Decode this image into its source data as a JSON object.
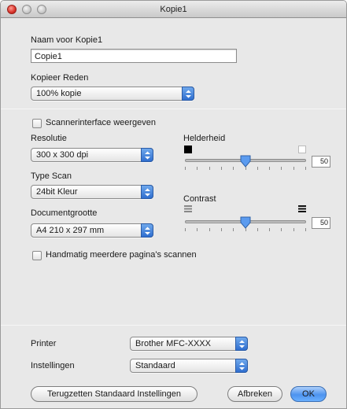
{
  "window": {
    "title": "Kopie1"
  },
  "name_section": {
    "label": "Naam voor Kopie1",
    "value": "Copie1"
  },
  "reason": {
    "label": "Kopieer Reden",
    "value": "100% kopie"
  },
  "scanner_interface": {
    "label": "Scannerinterface weergeven",
    "checked": false
  },
  "resolution": {
    "label": "Resolutie",
    "value": "300 x 300 dpi"
  },
  "scan_type": {
    "label": "Type Scan",
    "value": "24bit Kleur"
  },
  "doc_size": {
    "label": "Documentgrootte",
    "value": "A4  210 x 297 mm"
  },
  "brightness": {
    "label": "Helderheid",
    "value": "50",
    "level": 50
  },
  "contrast": {
    "label": "Contrast",
    "value": "50",
    "level": 50
  },
  "manual_multi": {
    "label": "Handmatig meerdere pagina's scannen",
    "checked": false
  },
  "printer": {
    "label": "Printer",
    "value": "Brother MFC-XXXX"
  },
  "settings": {
    "label": "Instellingen",
    "value": "Standaard"
  },
  "buttons": {
    "reset": "Terugzetten Standaard Instellingen",
    "cancel": "Afbreken",
    "ok": "OK"
  },
  "colors": {
    "accent": "#3b82e8",
    "window_bg": "#e8e8e8"
  }
}
